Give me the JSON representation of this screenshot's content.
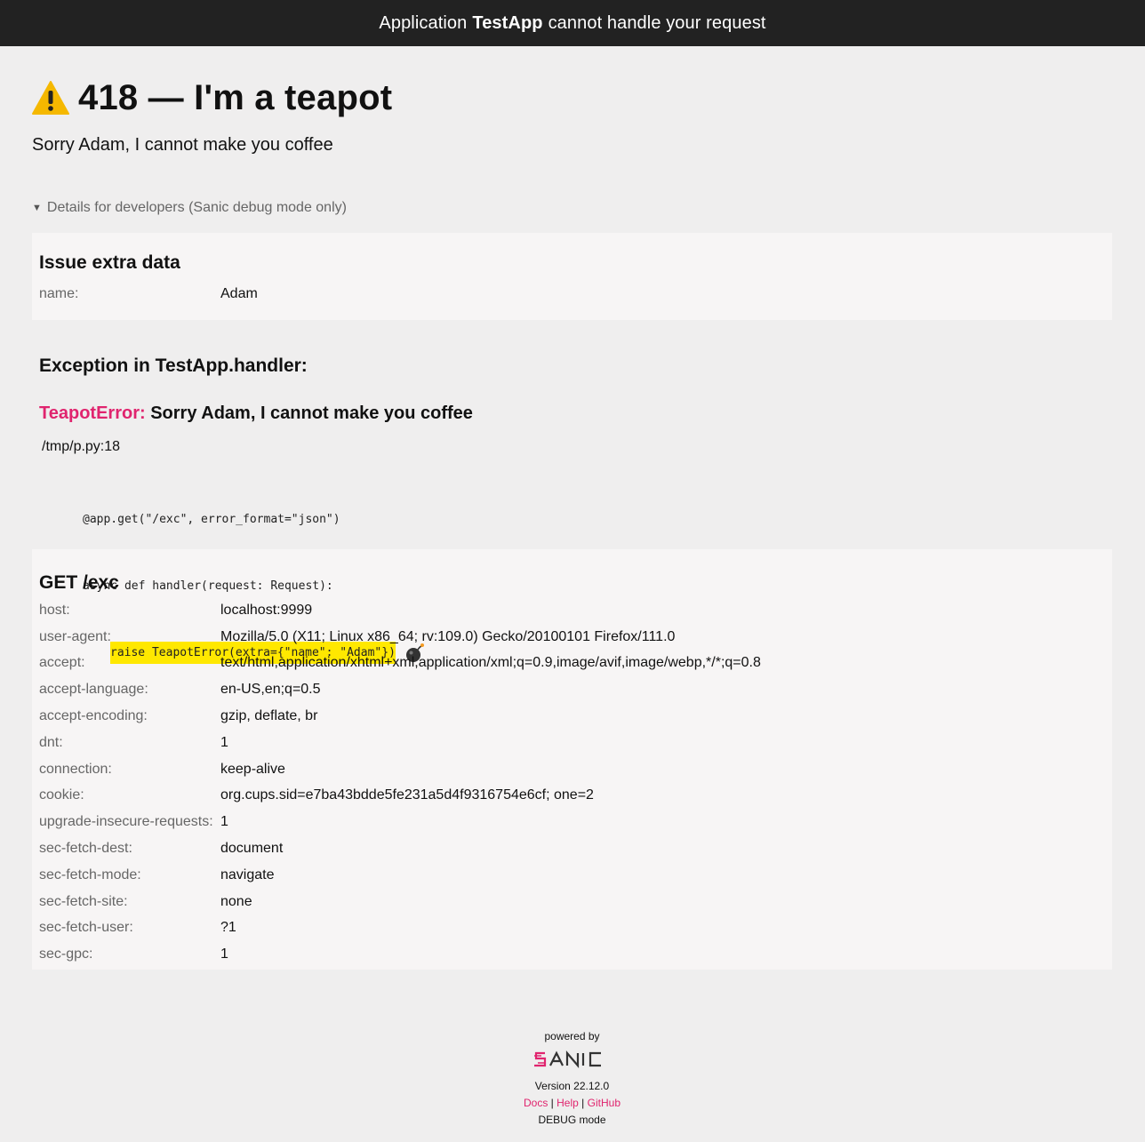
{
  "header": {
    "prefix": "Application",
    "app_name": "TestApp",
    "suffix": "cannot handle your request"
  },
  "error": {
    "title": "418 — I'm a teapot",
    "message": "Sorry Adam, I cannot make you coffee"
  },
  "details": {
    "summary": "Details for developers (Sanic debug mode only)"
  },
  "extra": {
    "heading": "Issue extra data",
    "rows": [
      {
        "key": "name:",
        "value": "Adam"
      }
    ]
  },
  "exception": {
    "heading": "Exception in TestApp.handler:",
    "type": "TeapotError:",
    "message": "Sorry Adam, I cannot make you coffee",
    "frame": "/tmp/p.py:18",
    "code": [
      "@app.get(\"/exc\", error_format=\"json\")",
      "async def handler(request: Request):",
      "raise TeapotError(extra={\"name\": \"Adam\"})"
    ]
  },
  "request": {
    "heading": "GET /exc",
    "headers": [
      {
        "key": "host:",
        "value": "localhost:9999"
      },
      {
        "key": "user-agent:",
        "value": "Mozilla/5.0 (X11; Linux x86_64; rv:109.0) Gecko/20100101 Firefox/111.0"
      },
      {
        "key": "accept:",
        "value": "text/html,application/xhtml+xml,application/xml;q=0.9,image/avif,image/webp,*/*;q=0.8"
      },
      {
        "key": "accept-language:",
        "value": "en-US,en;q=0.5"
      },
      {
        "key": "accept-encoding:",
        "value": "gzip, deflate, br"
      },
      {
        "key": "dnt:",
        "value": "1"
      },
      {
        "key": "connection:",
        "value": "keep-alive"
      },
      {
        "key": "cookie:",
        "value": "org.cups.sid=e7ba43bdde5fe231a5d4f9316754e6cf; one=2"
      },
      {
        "key": "upgrade-insecure-requests:",
        "value": "1"
      },
      {
        "key": "sec-fetch-dest:",
        "value": "document"
      },
      {
        "key": "sec-fetch-mode:",
        "value": "navigate"
      },
      {
        "key": "sec-fetch-site:",
        "value": "none"
      },
      {
        "key": "sec-fetch-user:",
        "value": "?1"
      },
      {
        "key": "sec-gpc:",
        "value": "1"
      }
    ]
  },
  "footer": {
    "powered_by": "powered by",
    "logo_text": "SANIC",
    "version": "Version 22.12.0",
    "links": [
      "Docs",
      "Help",
      "GitHub"
    ],
    "separator": "|",
    "mode": "DEBUG mode"
  },
  "colors": {
    "topbar": "#222222",
    "accent": "#e0246e",
    "highlight": "#ffe800",
    "warning": "#f5b800"
  },
  "icons": {
    "title": "warning-icon",
    "code": "bomb-icon",
    "details": "triangle-down-icon"
  }
}
